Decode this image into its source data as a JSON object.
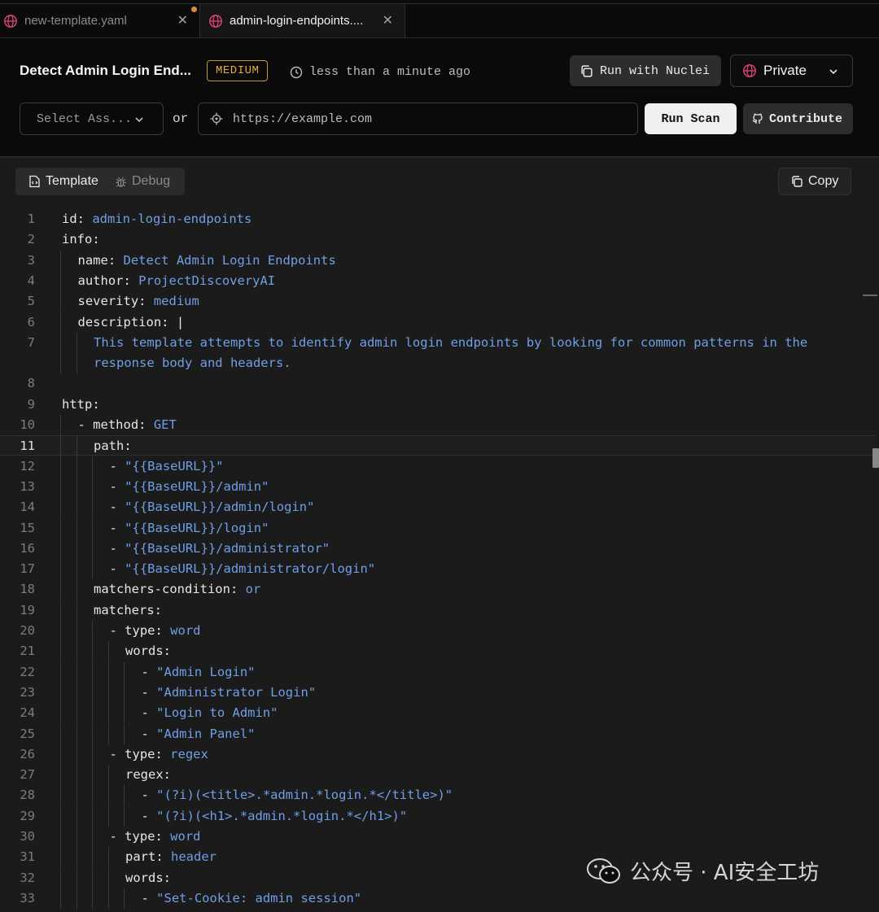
{
  "tabs": [
    {
      "label": "new-template.yaml",
      "icon": "globe-icon",
      "active": false,
      "modified": true
    },
    {
      "label": "admin-login-endpoints....",
      "icon": "globe-icon",
      "active": true
    }
  ],
  "header": {
    "title": "Detect Admin Login End...",
    "severity_badge": "MEDIUM",
    "timestamp": "less than a minute ago",
    "run_nuclei_label": "Run with Nuclei",
    "visibility_label": "Private"
  },
  "scan": {
    "asset_select_label": "Select Ass...",
    "or_label": "or",
    "url_placeholder": "https://example.com",
    "run_scan_label": "Run Scan",
    "contribute_label": "Contribute"
  },
  "editor": {
    "tab_template": "Template",
    "tab_debug": "Debug",
    "copy_label": "Copy",
    "current_line": 11,
    "lines": [
      {
        "n": "1",
        "indent": 0,
        "key": "id:",
        "val": "admin-login-endpoints"
      },
      {
        "n": "2",
        "indent": 0,
        "key": "info:",
        "val": ""
      },
      {
        "n": "3",
        "indent": 1,
        "key": "name:",
        "val": "Detect Admin Login Endpoints"
      },
      {
        "n": "4",
        "indent": 1,
        "key": "author:",
        "val": "ProjectDiscoveryAI"
      },
      {
        "n": "5",
        "indent": 1,
        "key": "severity:",
        "val": "medium"
      },
      {
        "n": "6",
        "indent": 1,
        "key": "description: |",
        "val": ""
      },
      {
        "n": "7",
        "indent": 2,
        "key": "",
        "val": "This template attempts to identify admin login endpoints by looking for common patterns in the"
      },
      {
        "n": "",
        "indent": 2,
        "key": "",
        "val": "response body and headers."
      },
      {
        "n": "8",
        "indent": 0,
        "key": "",
        "val": ""
      },
      {
        "n": "9",
        "indent": 0,
        "key": "http:",
        "val": ""
      },
      {
        "n": "10",
        "indent": 1,
        "key": "- method:",
        "val": "GET"
      },
      {
        "n": "11",
        "indent": 2,
        "key": "path:",
        "val": ""
      },
      {
        "n": "12",
        "indent": 3,
        "key": "- ",
        "val": "\"{{BaseURL}}\""
      },
      {
        "n": "13",
        "indent": 3,
        "key": "- ",
        "val": "\"{{BaseURL}}/admin\""
      },
      {
        "n": "14",
        "indent": 3,
        "key": "- ",
        "val": "\"{{BaseURL}}/admin/login\""
      },
      {
        "n": "15",
        "indent": 3,
        "key": "- ",
        "val": "\"{{BaseURL}}/login\""
      },
      {
        "n": "16",
        "indent": 3,
        "key": "- ",
        "val": "\"{{BaseURL}}/administrator\""
      },
      {
        "n": "17",
        "indent": 3,
        "key": "- ",
        "val": "\"{{BaseURL}}/administrator/login\""
      },
      {
        "n": "18",
        "indent": 2,
        "key": "matchers-condition:",
        "val": "or"
      },
      {
        "n": "19",
        "indent": 2,
        "key": "matchers:",
        "val": ""
      },
      {
        "n": "20",
        "indent": 3,
        "key": "- type:",
        "val": "word"
      },
      {
        "n": "21",
        "indent": 4,
        "key": "words:",
        "val": ""
      },
      {
        "n": "22",
        "indent": 5,
        "key": "- ",
        "val": "\"Admin Login\""
      },
      {
        "n": "23",
        "indent": 5,
        "key": "- ",
        "val": "\"Administrator Login\""
      },
      {
        "n": "24",
        "indent": 5,
        "key": "- ",
        "val": "\"Login to Admin\""
      },
      {
        "n": "25",
        "indent": 5,
        "key": "- ",
        "val": "\"Admin Panel\""
      },
      {
        "n": "26",
        "indent": 3,
        "key": "- type:",
        "val": "regex"
      },
      {
        "n": "27",
        "indent": 4,
        "key": "regex:",
        "val": ""
      },
      {
        "n": "28",
        "indent": 5,
        "key": "- ",
        "val": "\"(?i)(<title>.*admin.*login.*</title>)\""
      },
      {
        "n": "29",
        "indent": 5,
        "key": "- ",
        "val": "\"(?i)(<h1>.*admin.*login.*</h1>)\""
      },
      {
        "n": "30",
        "indent": 3,
        "key": "- type:",
        "val": "word"
      },
      {
        "n": "31",
        "indent": 4,
        "key": "part:",
        "val": "header"
      },
      {
        "n": "32",
        "indent": 4,
        "key": "words:",
        "val": ""
      },
      {
        "n": "33",
        "indent": 5,
        "key": "- ",
        "val": "\"Set-Cookie: admin session\""
      }
    ]
  },
  "watermark": "公众号 · AI安全工坊",
  "colors": {
    "background": "#0d0d0d",
    "editor_bg": "#1b1b1b",
    "yaml_key": "#e6e6e6",
    "yaml_value": "#6f9fe6",
    "severity_medium": "#e0ad3d",
    "globe_accent": "#e0457b"
  }
}
